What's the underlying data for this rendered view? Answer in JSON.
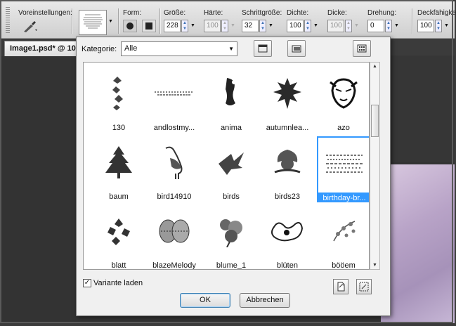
{
  "options_bar": {
    "presets_label": "Voreinstellungen:",
    "form_label": "Form:",
    "size_label": "Größe:",
    "size_value": "228",
    "hardness_label": "Härte:",
    "hardness_value": "100",
    "step_label": "Schrittgröße:",
    "step_value": "32",
    "density_label": "Dichte:",
    "density_value": "100",
    "thickness_label": "Dicke:",
    "thickness_value": "100",
    "rotation_label": "Drehung:",
    "rotation_value": "0",
    "opacity_label": "Deckfähigkeit",
    "opacity_value": "100"
  },
  "document_tab": {
    "title": "Image1.psd* @ 10"
  },
  "dialog": {
    "category_label": "Kategorie:",
    "category_value": "Alle",
    "brushes": [
      {
        "name": "130"
      },
      {
        "name": "andlostmy..."
      },
      {
        "name": "anima"
      },
      {
        "name": "autumnlea..."
      },
      {
        "name": "azo"
      },
      {
        "name": "baum"
      },
      {
        "name": "bird14910"
      },
      {
        "name": "birds"
      },
      {
        "name": "birds23"
      },
      {
        "name": "birthday-br...",
        "selected": true
      },
      {
        "name": "blatt"
      },
      {
        "name": "blazeMelody"
      },
      {
        "name": "blume_1"
      },
      {
        "name": "blüten"
      },
      {
        "name": "bööem"
      }
    ],
    "load_variant_label": "Variante laden",
    "load_variant_checked": true,
    "ok_label": "OK",
    "cancel_label": "Abbrechen",
    "selection_color": "#3399ff"
  }
}
